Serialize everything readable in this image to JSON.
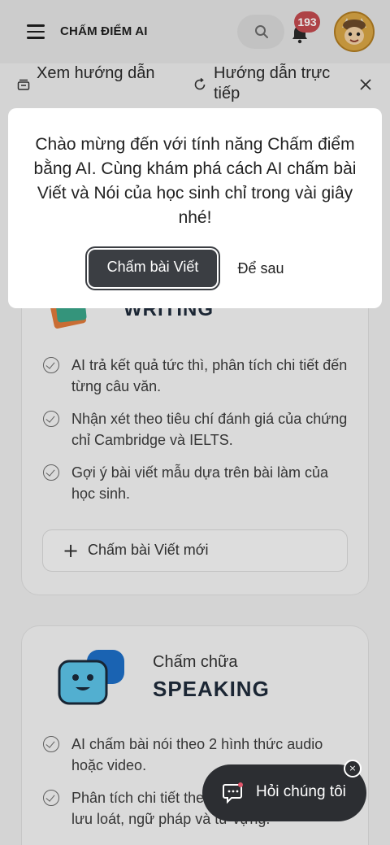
{
  "header": {
    "title": "CHẤM ĐIỂM AI",
    "notification_count": "193",
    "icons": {
      "menu": "hamburger-icon",
      "search": "search-icon",
      "bell": "bell-icon",
      "avatar": "avatar-icon"
    }
  },
  "guide_bar": {
    "view_guide": "Xem hướng dẫn",
    "live_guide": "Hướng dẫn trực tiếp"
  },
  "dialog": {
    "message": "Chào mừng đến với tính năng Chấm điểm bằng AI. Cùng khám phá cách AI chấm bài Viết và Nói của học sinh chỉ trong vài giây nhé!",
    "primary_label": "Chấm bài Viết",
    "secondary_label": "Để sau"
  },
  "writing_card": {
    "title": "WRITING",
    "features": [
      "AI trả kết quả tức thì, phân tích chi tiết đến từng câu văn.",
      "Nhận xét theo tiêu chí đánh giá của chứng chỉ Cambridge và IELTS.",
      "Gợi ý bài viết mẫu dựa trên bài làm của học sinh."
    ],
    "new_button_label": "Chấm bài Viết mới"
  },
  "speaking_card": {
    "subtitle": "Chấm chữa",
    "title": "SPEAKING",
    "features": [
      "AI chấm bài nói theo 2 hình thức audio hoặc video.",
      "Phân tích chi tiết theo tiêu chí phát âm, độ lưu loát, ngữ pháp và từ vựng."
    ]
  },
  "chat_fab": {
    "label": "Hỏi chúng tôi",
    "close": "×"
  },
  "colors": {
    "primary_button": "#3b3e43",
    "badge": "#c24a4f",
    "fab": "#2c2e32"
  }
}
